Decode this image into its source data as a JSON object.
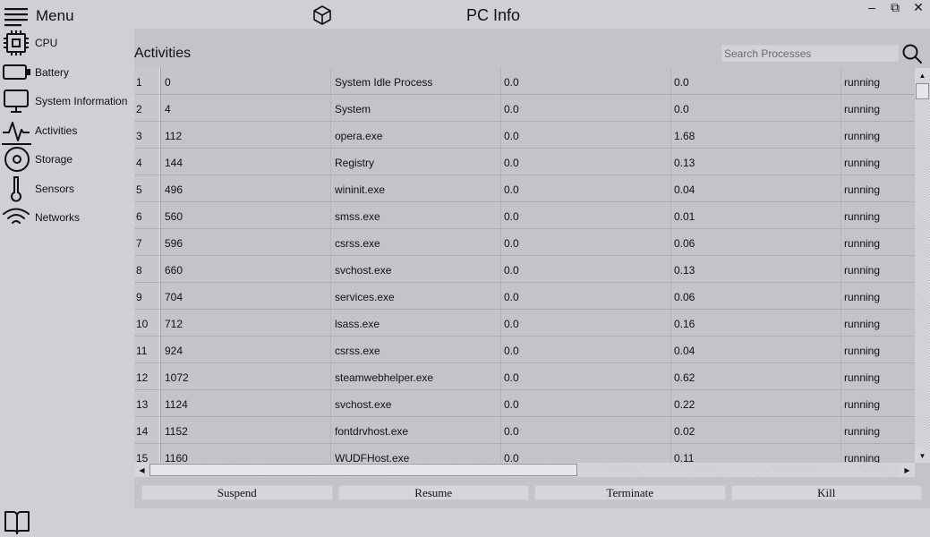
{
  "titlebar": {
    "menu_label": "Menu",
    "app_title": "PC Info",
    "controls": {
      "minimize": "–",
      "restore": "⧉",
      "close": "✕"
    }
  },
  "sidebar": {
    "items": [
      {
        "label": "CPU",
        "icon": "cpu-icon"
      },
      {
        "label": "Battery",
        "icon": "battery-icon"
      },
      {
        "label": "System Information",
        "icon": "monitor-icon"
      },
      {
        "label": "Activities",
        "icon": "activity-icon",
        "active": true
      },
      {
        "label": "Storage",
        "icon": "disk-icon"
      },
      {
        "label": "Sensors",
        "icon": "thermometer-icon"
      },
      {
        "label": "Networks",
        "icon": "wifi-icon"
      }
    ],
    "bottom_icon": "book-icon"
  },
  "main": {
    "title": "Activities",
    "search_placeholder": "Search Processes",
    "rows": [
      [
        "1",
        "0",
        "System Idle Process",
        "0.0",
        "0.0",
        "running"
      ],
      [
        "2",
        "4",
        "System",
        "0.0",
        "0.0",
        "running"
      ],
      [
        "3",
        "112",
        "opera.exe",
        "0.0",
        "1.68",
        "running"
      ],
      [
        "4",
        "144",
        "Registry",
        "0.0",
        "0.13",
        "running"
      ],
      [
        "5",
        "496",
        "wininit.exe",
        "0.0",
        "0.04",
        "running"
      ],
      [
        "6",
        "560",
        "smss.exe",
        "0.0",
        "0.01",
        "running"
      ],
      [
        "7",
        "596",
        "csrss.exe",
        "0.0",
        "0.06",
        "running"
      ],
      [
        "8",
        "660",
        "svchost.exe",
        "0.0",
        "0.13",
        "running"
      ],
      [
        "9",
        "704",
        "services.exe",
        "0.0",
        "0.06",
        "running"
      ],
      [
        "10",
        "712",
        "lsass.exe",
        "0.0",
        "0.16",
        "running"
      ],
      [
        "11",
        "924",
        "csrss.exe",
        "0.0",
        "0.04",
        "running"
      ],
      [
        "12",
        "1072",
        "steamwebhelper.exe",
        "0.0",
        "0.62",
        "running"
      ],
      [
        "13",
        "1124",
        "svchost.exe",
        "0.0",
        "0.22",
        "running"
      ],
      [
        "14",
        "1152",
        "fontdrvhost.exe",
        "0.0",
        "0.02",
        "running"
      ],
      [
        "15",
        "1160",
        "WUDFHost.exe",
        "0.0",
        "0.11",
        "running"
      ]
    ],
    "actions": {
      "suspend": "Suspend",
      "resume": "Resume",
      "terminate": "Terminate",
      "kill": "Kill"
    }
  }
}
